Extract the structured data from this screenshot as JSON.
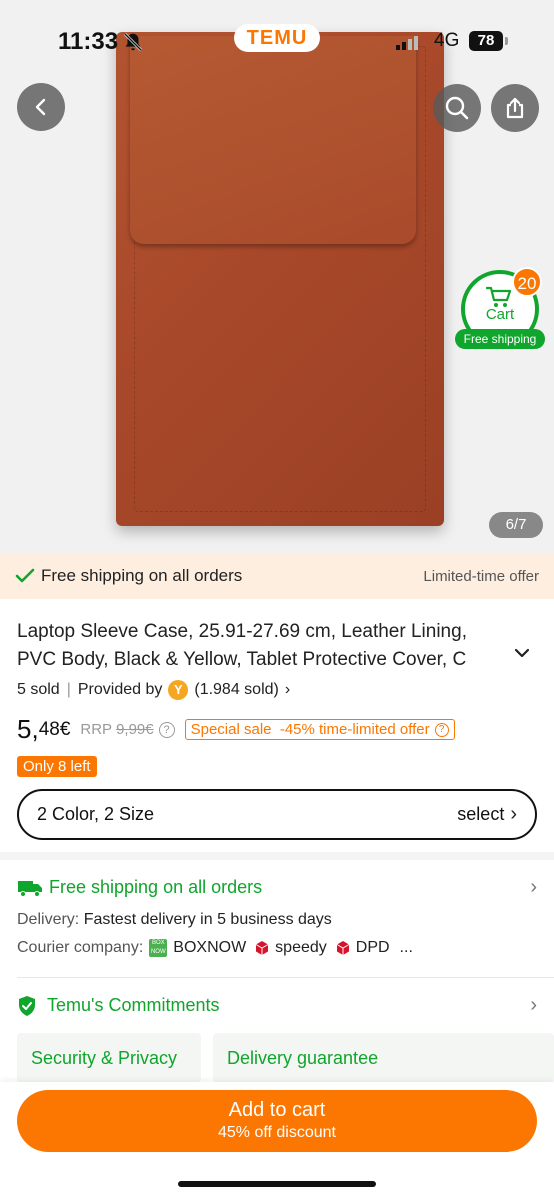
{
  "status_bar": {
    "time": "11:33",
    "network": "4G",
    "battery": "78",
    "app_logo": "TEMU"
  },
  "hero": {
    "image_counter": "6/7",
    "cart": {
      "badge_count": "20",
      "label": "Cart",
      "shipping_label": "Free shipping"
    }
  },
  "promo": {
    "text": "Free shipping on all orders",
    "right_text": "Limited-time offer"
  },
  "product": {
    "title": "Laptop Sleeve Case, 25.91-27.69 cm, Leather Lining, PVC Body, Black & Yellow, Tablet Protective Cover, C",
    "sold": "5 sold",
    "provided_by": "Provided by",
    "seller_initial": "Y",
    "seller_sold": "(1.984 sold)",
    "price_main": "5,",
    "price_rest": "48€",
    "rrp_label": "RRP",
    "rrp_value": "9,99€",
    "special_offer": "Special sale  -45% time-limited offer",
    "stock": "Only 8 left",
    "variant_label": "2 Color, 2 Size",
    "variant_select": "select"
  },
  "shipping": {
    "title": "Free shipping on all orders",
    "delivery_label": "Delivery:",
    "delivery_value": "Fastest delivery in 5 business days",
    "courier_label": "Courier company:",
    "couriers": [
      "BOXNOW",
      "speedy",
      "DPD"
    ],
    "more": "..."
  },
  "commitments": {
    "title": "Temu's Commitments",
    "cards": [
      "Security & Privacy",
      "Delivery guarantee"
    ]
  },
  "bottom": {
    "add_to_cart": "Add to cart",
    "discount": "45% off discount"
  },
  "colors": {
    "brand_orange": "#fb7701",
    "green": "#10a52c",
    "product_leather": "#a8482a"
  },
  "icons": [
    "back-icon",
    "search-icon",
    "share-icon",
    "cart-icon",
    "check-icon",
    "truck-icon",
    "shield-icon",
    "chevron-right-icon",
    "chevron-down-icon",
    "bell-muted-icon"
  ]
}
